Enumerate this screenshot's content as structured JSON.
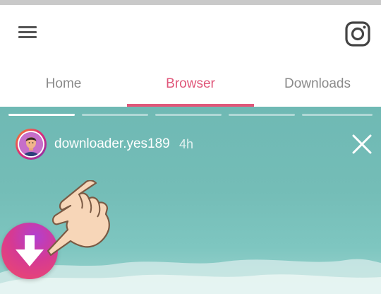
{
  "status_bar": {},
  "app_bar": {
    "menu_icon": "hamburger-menu-icon",
    "instagram_icon": "instagram-icon"
  },
  "tabs": {
    "items": [
      {
        "label": "Home",
        "active": false
      },
      {
        "label": "Browser",
        "active": true
      },
      {
        "label": "Downloads",
        "active": false
      }
    ],
    "active_color": "#e0577a",
    "inactive_color": "#8a8a8a"
  },
  "story": {
    "progress_segments": 5,
    "progress_filled_fraction": [
      0.9,
      0,
      0,
      0,
      0
    ],
    "username": "downloader.yes189",
    "time_ago": "4h",
    "close_icon": "close-icon",
    "avatar_icon": "avatar-icon",
    "background_color": "#74bdb7"
  },
  "download_button": {
    "icon": "download-arrow-icon",
    "gradient_colors": [
      "#b23fd0",
      "#d63a92",
      "#ef4a6a"
    ]
  },
  "pointer_hand_icon": "pointing-hand-icon"
}
